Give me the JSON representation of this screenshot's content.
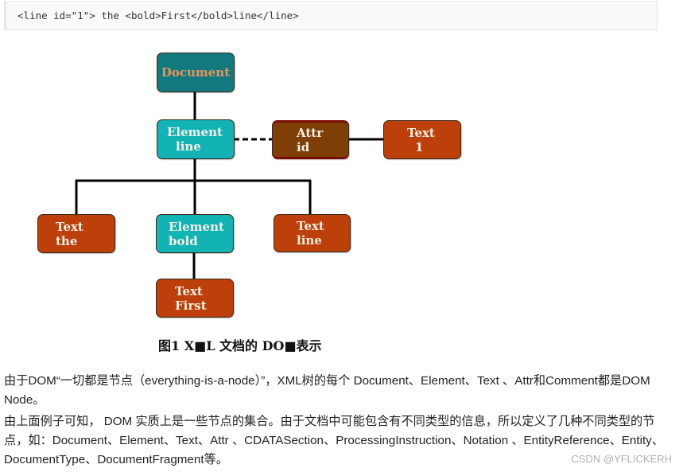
{
  "code_block": {
    "text": "<line id=\"1\"> the <bold>First</bold>line</line>"
  },
  "diagram": {
    "colors": {
      "document_bg": "#12797f",
      "document_text": "#e9935a",
      "element_bg": "#12b3b5",
      "attr_bg": "#7e3f06",
      "text_bg": "#bd3f0a",
      "node_text": "#f3f0e6",
      "edge": "#000000"
    },
    "nodes": [
      {
        "id": "document",
        "type": "Document",
        "lines": [
          "Document"
        ]
      },
      {
        "id": "element-line",
        "type": "Element",
        "lines": [
          "Element",
          "line"
        ]
      },
      {
        "id": "attr-id",
        "type": "Attr",
        "lines": [
          "Attr",
          "id"
        ]
      },
      {
        "id": "text-1",
        "type": "Text",
        "lines": [
          "Text",
          "1"
        ]
      },
      {
        "id": "text-the",
        "type": "Text",
        "lines": [
          "Text",
          "the"
        ]
      },
      {
        "id": "element-bold",
        "type": "Element",
        "lines": [
          "Element",
          "bold"
        ]
      },
      {
        "id": "text-line",
        "type": "Text",
        "lines": [
          "Text",
          "line"
        ]
      },
      {
        "id": "text-first",
        "type": "Text",
        "lines": [
          "Text",
          "First"
        ]
      }
    ],
    "edges": [
      {
        "from": "document",
        "to": "element-line",
        "style": "solid"
      },
      {
        "from": "element-line",
        "to": "attr-id",
        "style": "dashed"
      },
      {
        "from": "attr-id",
        "to": "text-1",
        "style": "solid"
      },
      {
        "from": "element-line",
        "to": "text-the",
        "style": "solid"
      },
      {
        "from": "element-line",
        "to": "element-bold",
        "style": "solid"
      },
      {
        "from": "element-line",
        "to": "text-line",
        "style": "solid"
      },
      {
        "from": "element-bold",
        "to": "text-first",
        "style": "solid"
      }
    ],
    "caption": "图1 X■L 文档的 DO■表示"
  },
  "paragraphs": [
    "由于DOM“一切都是节点（everything-is-a-node）”，XML树的每个 Document、Element、Text 、Attr和Comment都是DOM Node。",
    "由上面例子可知， DOM 实质上是一些节点的集合。由于文档中可能包含有不同类型的信息，所以定义了几种不同类型的节点，如：Document、Element、Text、Attr 、CDATASection、ProcessingInstruction、Notation 、EntityReference、Entity、DocumentType、DocumentFragment等。"
  ],
  "watermark": "CSDN @YFLICKERH"
}
